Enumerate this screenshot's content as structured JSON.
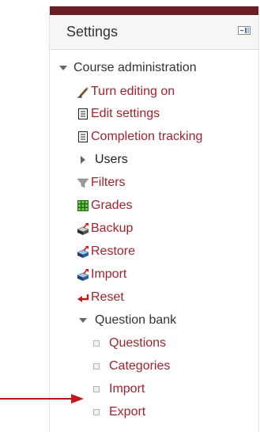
{
  "block": {
    "title": "Settings",
    "accent_color": "#6d1e24",
    "link_color": "#a0232d"
  },
  "course_admin": {
    "label": "Course administration",
    "items": [
      {
        "label": "Turn editing on",
        "icon": "pencil-icon"
      },
      {
        "label": "Edit settings",
        "icon": "document-icon"
      },
      {
        "label": "Completion tracking",
        "icon": "document-icon"
      },
      {
        "label": "Users",
        "icon": "collapsed-triangle-icon"
      },
      {
        "label": "Filters",
        "icon": "funnel-icon"
      },
      {
        "label": "Grades",
        "icon": "grades-icon"
      },
      {
        "label": "Backup",
        "icon": "backup-icon"
      },
      {
        "label": "Restore",
        "icon": "restore-icon"
      },
      {
        "label": "Import",
        "icon": "import-icon"
      },
      {
        "label": "Reset",
        "icon": "reset-icon"
      }
    ]
  },
  "question_bank": {
    "label": "Question bank",
    "items": [
      {
        "label": "Questions"
      },
      {
        "label": "Categories"
      },
      {
        "label": "Import"
      },
      {
        "label": "Export"
      }
    ]
  },
  "annotation": {
    "pointer": "red-arrow-icon",
    "color": "#c0151b"
  }
}
